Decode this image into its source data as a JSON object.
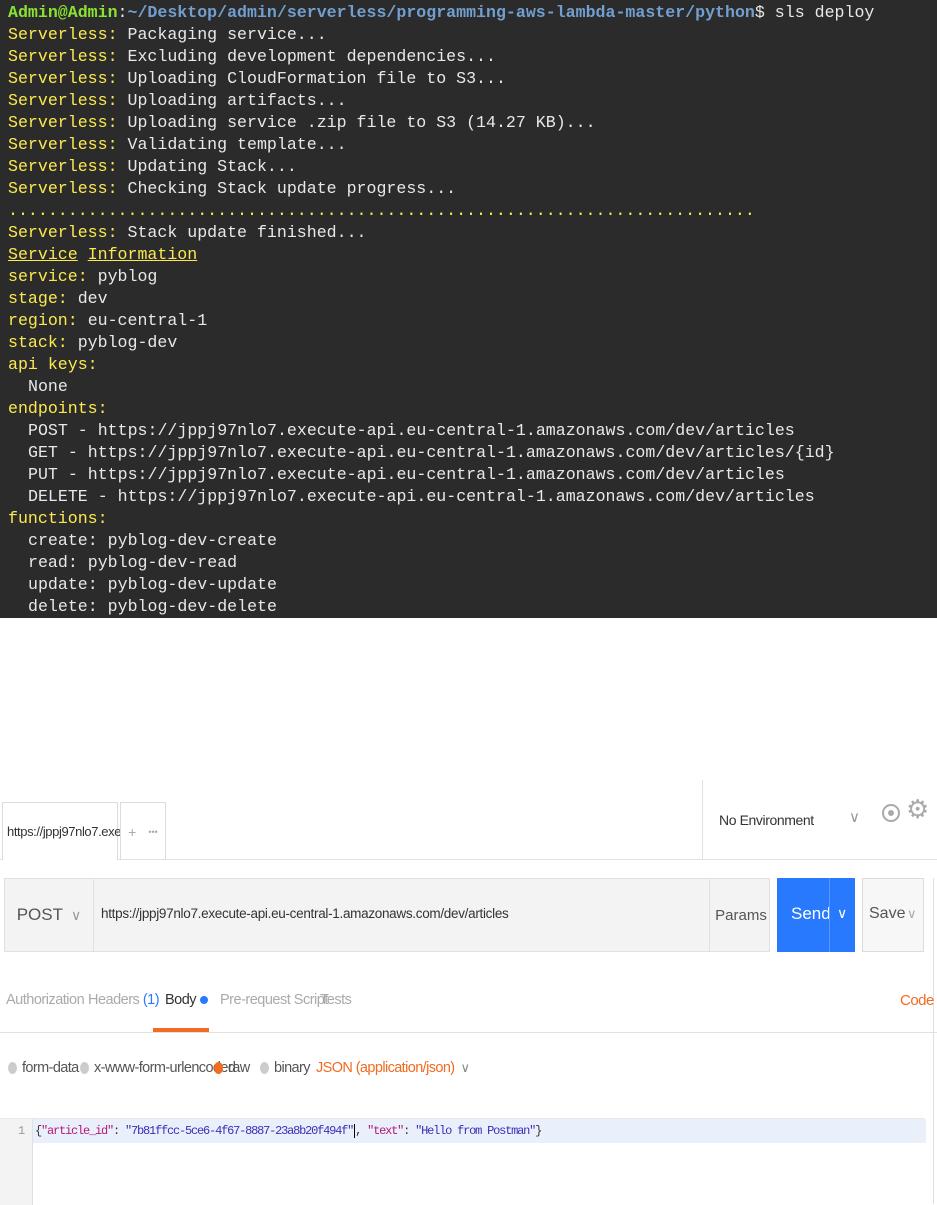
{
  "terminal": {
    "prompt_user": "Admin@Admin",
    "prompt_path": "~/Desktop/admin/serverless/programming-aws-lambda-master/python",
    "prompt_command": "$ sls deploy",
    "log_prefix": "Serverless:",
    "log_lines": [
      "Packaging service...",
      "Excluding development dependencies...",
      "Uploading CloudFormation file to S3...",
      "Uploading artifacts...",
      "Uploading service .zip file to S3 (14.27 KB)...",
      "Validating template...",
      "Updating Stack...",
      "Checking Stack update progress..."
    ],
    "progress_dots": "...........................................................................",
    "finished_msg": "Stack update finished...",
    "info_header_1": "Service",
    "info_header_2": "Information",
    "service_key": "service:",
    "service_val": "pyblog",
    "stage_key": "stage:",
    "stage_val": "dev",
    "region_key": "region:",
    "region_val": "eu-central-1",
    "stack_key": "stack:",
    "stack_val": "pyblog-dev",
    "api_keys_key": "api keys:",
    "api_keys_val": "None",
    "endpoints_key": "endpoints:",
    "endpoints": [
      "POST - https://jppj97nlo7.execute-api.eu-central-1.amazonaws.com/dev/articles",
      "GET - https://jppj97nlo7.execute-api.eu-central-1.amazonaws.com/dev/articles/{id}",
      "PUT - https://jppj97nlo7.execute-api.eu-central-1.amazonaws.com/dev/articles",
      "DELETE - https://jppj97nlo7.execute-api.eu-central-1.amazonaws.com/dev/articles"
    ],
    "functions_key": "functions:",
    "functions": [
      "create: pyblog-dev-create",
      "read: pyblog-dev-read",
      "update: pyblog-dev-update",
      "delete: pyblog-dev-delete"
    ]
  },
  "postman": {
    "request_tab": "https://jppj97nlo7.exe",
    "tab_add": "+",
    "tab_more": "•••",
    "environment": "No Environment",
    "method": "POST",
    "url": "https://jppj97nlo7.execute-api.eu-central-1.amazonaws.com/dev/articles",
    "params_label": "Params",
    "send_label": "Send",
    "save_label": "Save",
    "tabs": {
      "authorization": "Authorization",
      "headers": "Headers",
      "headers_count": "(1)",
      "body": "Body",
      "prerequest": "Pre-request Script",
      "tests": "Tests",
      "code": "Code"
    },
    "body_options": {
      "form_data": "form-data",
      "urlencoded": "x-www-form-urlencoded",
      "raw": "raw",
      "binary": "binary",
      "content_type": "JSON (application/json)"
    },
    "editor": {
      "line_number": "1",
      "key1": "\"article_id\"",
      "val1": "\"7b81ffcc-5ce6-4f67-8887-23a8b20f494f\"",
      "key2": "\"text\"",
      "val2": "\"Hello from Postman\""
    },
    "colors": {
      "accent_orange": "#f26b21",
      "send_blue": "#2979ff"
    }
  }
}
